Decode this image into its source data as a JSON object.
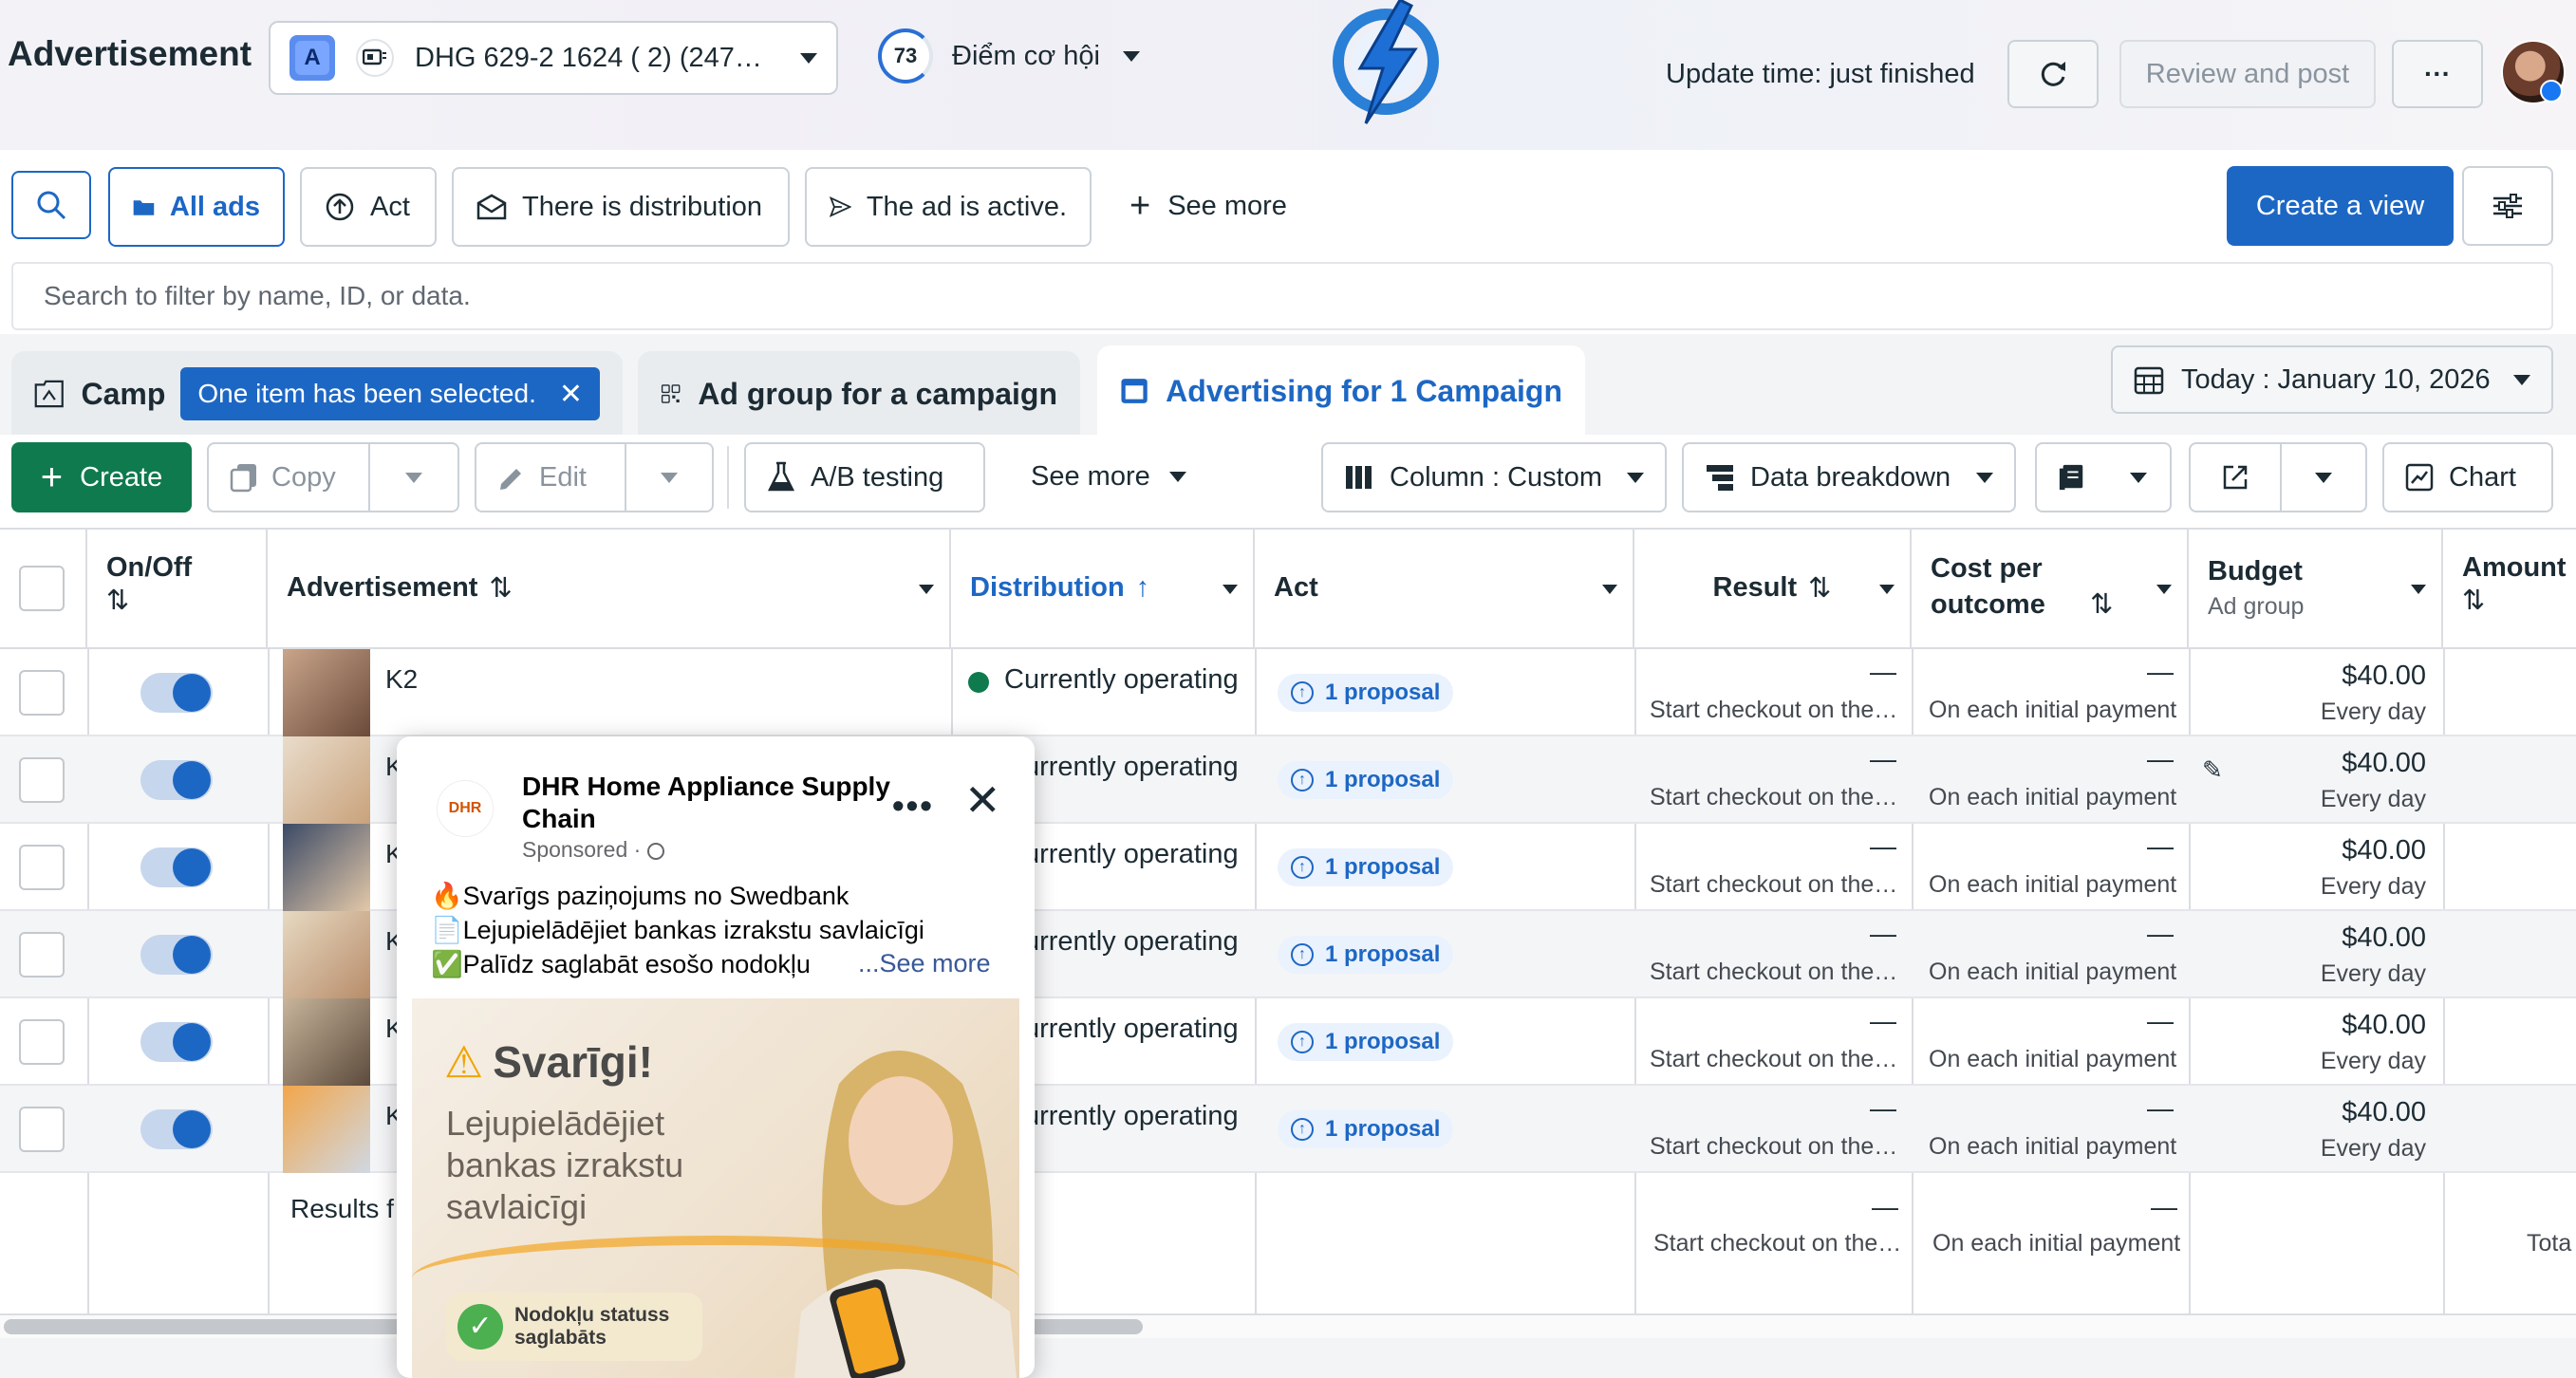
{
  "header": {
    "title": "Advertisement",
    "account_badge": "A",
    "account_name": "DHG 629-2 1624 ( 2) (247…",
    "score": "73",
    "score_label": "Điểm cơ hội",
    "update_time": "Update time: just finished",
    "review_label": "Review and post",
    "more_label": "···"
  },
  "filters": {
    "all_ads": "All ads",
    "act": "Act",
    "distribution": "There is distribution",
    "active": "The ad is active.",
    "see_more": "See more",
    "create_view": "Create a view",
    "search_placeholder": "Search to filter by name, ID, or data."
  },
  "tabs": {
    "camp": "Camp",
    "selected_badge": "One item has been selected.",
    "ad_group": "Ad group for a campaign",
    "advertising": "Advertising for 1 Campaign",
    "date": "Today : January 10, 2026"
  },
  "toolbar": {
    "create": "Create",
    "copy": "Copy",
    "edit": "Edit",
    "ab_testing": "A/B testing",
    "see_more": "See more",
    "column": "Column : Custom",
    "breakdown": "Data breakdown",
    "chart": "Chart"
  },
  "table": {
    "headers": {
      "onoff": "On/Off",
      "advertisement": "Advertisement",
      "distribution": "Distribution",
      "act": "Act",
      "result": "Result",
      "cost": "Cost per outcome",
      "budget": "Budget",
      "budget_sub": "Ad group",
      "amount": "Amount"
    },
    "rows": [
      {
        "name": "K2",
        "status": "Currently operating",
        "act": "1 proposal",
        "result": "—",
        "result_sub": "Start checkout on the…",
        "cost": "—",
        "cost_sub": "On each initial payment",
        "budget": "$40.00",
        "budget_sub": "Every day"
      },
      {
        "name": "K",
        "status": "Currently operating",
        "act": "1 proposal",
        "result": "—",
        "result_sub": "Start checkout on the…",
        "cost": "—",
        "cost_sub": "On each initial payment",
        "budget": "$40.00",
        "budget_sub": "Every day"
      },
      {
        "name": "K",
        "status": "Currently operating",
        "act": "1 proposal",
        "result": "—",
        "result_sub": "Start checkout on the…",
        "cost": "—",
        "cost_sub": "On each initial payment",
        "budget": "$40.00",
        "budget_sub": "Every day"
      },
      {
        "name": "K",
        "status": "Currently operating",
        "act": "1 proposal",
        "result": "—",
        "result_sub": "Start checkout on the…",
        "cost": "—",
        "cost_sub": "On each initial payment",
        "budget": "$40.00",
        "budget_sub": "Every day"
      },
      {
        "name": "K",
        "status": "Currently operating",
        "act": "1 proposal",
        "result": "—",
        "result_sub": "Start checkout on the…",
        "cost": "—",
        "cost_sub": "On each initial payment",
        "budget": "$40.00",
        "budget_sub": "Every day"
      },
      {
        "name": "K",
        "status": "Currently operating",
        "act": "1 proposal",
        "result": "—",
        "result_sub": "Start checkout on the…",
        "cost": "—",
        "cost_sub": "On each initial payment",
        "budget": "$40.00",
        "budget_sub": "Every day"
      }
    ],
    "summary": {
      "label": "Results f",
      "result": "—",
      "result_sub": "Start checkout on the…",
      "cost": "—",
      "cost_sub": "On each initial payment",
      "total": "Tota"
    }
  },
  "preview": {
    "page_name": "DHR Home Appliance Supply Chain",
    "logo_text": "DHR",
    "sponsored": "Sponsored ·",
    "line1": "🔥Svarīgs paziņojums no Swedbank",
    "line2": "📄Lejupielādējiet bankas izrakstu savlaicīgi",
    "line3": "✅Palīdz saglabāt esošo nodokļu",
    "see_more": "...See more",
    "headline": "Svarīgi!",
    "subtext": "Lejupielādējiet bankas izrakstu savlaicīgi",
    "badge": "Nodokļu statuss saglabāts"
  },
  "colors": {
    "accent": "#1d67c4",
    "create_green": "#0f7a4d",
    "status_green": "#0f7a4d"
  }
}
